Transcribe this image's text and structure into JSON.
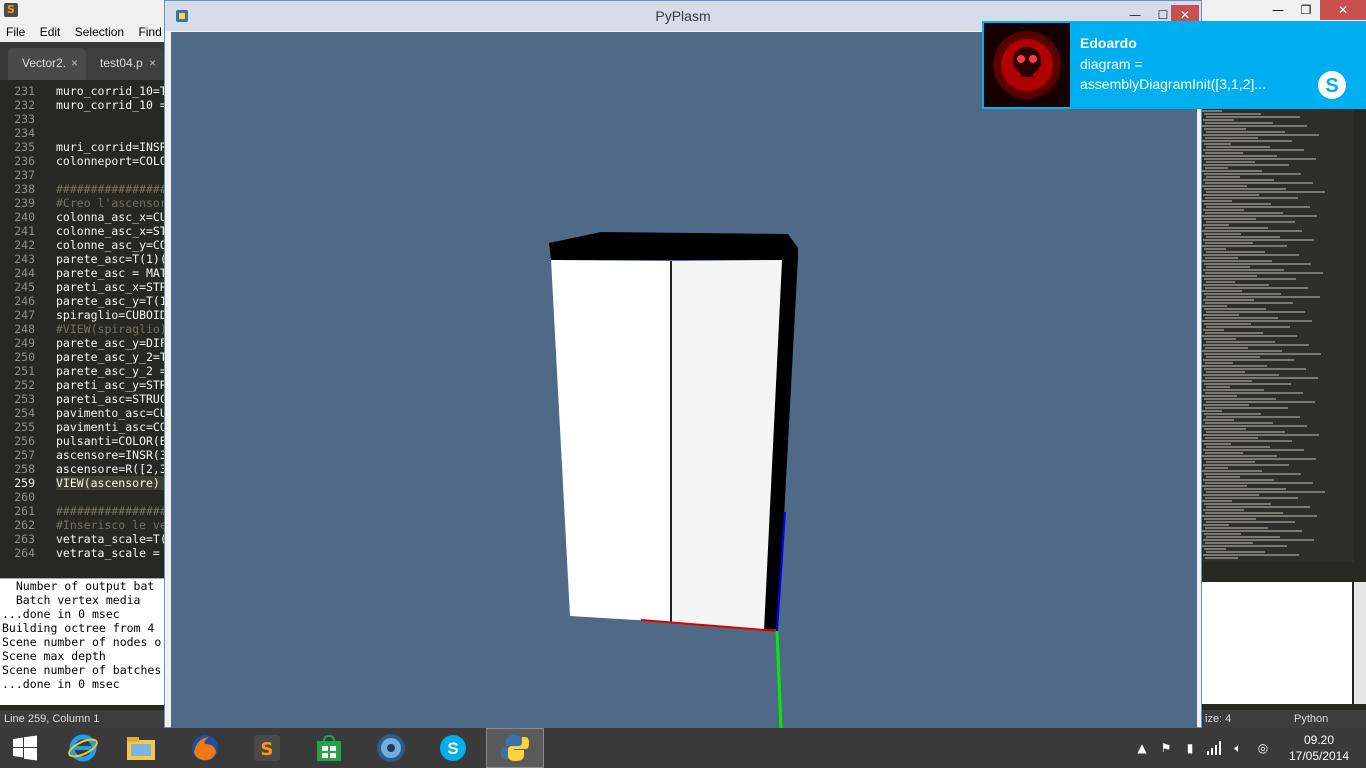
{
  "editor": {
    "menu": [
      "File",
      "Edit",
      "Selection",
      "Find"
    ],
    "tabs": [
      {
        "label": "Vector2.",
        "close": "×"
      },
      {
        "label": "test04.p",
        "close": "×"
      }
    ],
    "lines": [
      {
        "n": "231",
        "code": "muro_corrid_10=T",
        "type": "code"
      },
      {
        "n": "232",
        "code": "muro_corrid_10 =",
        "type": "code"
      },
      {
        "n": "233",
        "code": "",
        "type": "code"
      },
      {
        "n": "234",
        "code": "",
        "type": "code"
      },
      {
        "n": "235",
        "code": "muri_corrid=INSR",
        "type": "code"
      },
      {
        "n": "236",
        "code": "colonneport=COLO",
        "type": "code"
      },
      {
        "n": "237",
        "code": "",
        "type": "code"
      },
      {
        "n": "238",
        "code": "################",
        "type": "com"
      },
      {
        "n": "239",
        "code": "#Creo l'ascensor",
        "type": "com"
      },
      {
        "n": "240",
        "code": "colonna_asc_x=CU",
        "type": "code"
      },
      {
        "n": "241",
        "code": "colonne_asc_x=ST",
        "type": "code"
      },
      {
        "n": "242",
        "code": "colonne_asc_y=CO",
        "type": "code"
      },
      {
        "n": "243",
        "code": "parete_asc=T(1)(",
        "type": "code"
      },
      {
        "n": "244",
        "code": "parete_asc = MAT",
        "type": "code"
      },
      {
        "n": "245",
        "code": "pareti_asc_x=STR",
        "type": "code"
      },
      {
        "n": "246",
        "code": "parete_asc_y=T(1",
        "type": "code"
      },
      {
        "n": "247",
        "code": "spiraglio=CUBOID",
        "type": "code"
      },
      {
        "n": "248",
        "code": "#VIEW(spiraglio)",
        "type": "com"
      },
      {
        "n": "249",
        "code": "parete_asc_y=DIF",
        "type": "code"
      },
      {
        "n": "250",
        "code": "parete_asc_y_2=T",
        "type": "code"
      },
      {
        "n": "251",
        "code": "parete_asc_y_2 =",
        "type": "code"
      },
      {
        "n": "252",
        "code": "pareti_asc_y=STR",
        "type": "code"
      },
      {
        "n": "253",
        "code": "pareti_asc=STRUC",
        "type": "code"
      },
      {
        "n": "254",
        "code": "pavimento_asc=CU",
        "type": "code"
      },
      {
        "n": "255",
        "code": "pavimenti_asc=CO",
        "type": "code"
      },
      {
        "n": "256",
        "code": "pulsanti=COLOR(B",
        "type": "code"
      },
      {
        "n": "257",
        "code": "ascensore=INSR(3",
        "type": "code"
      },
      {
        "n": "258",
        "code": "ascensore=R([2,3",
        "type": "code"
      },
      {
        "n": "259",
        "code": "VIEW(ascensore)",
        "type": "cur"
      },
      {
        "n": "260",
        "code": "",
        "type": "code"
      },
      {
        "n": "261",
        "code": "################",
        "type": "com"
      },
      {
        "n": "262",
        "code": "#Inserisco le ve",
        "type": "com"
      },
      {
        "n": "263",
        "code": "vetrata_scale=T(",
        "type": "code"
      },
      {
        "n": "264",
        "code": "vetrata_scale =",
        "type": "code"
      }
    ],
    "console": [
      "  Number of output bat",
      "  Batch vertex media",
      "...done in 0 msec",
      "Building octree from 4",
      "Scene number of nodes o",
      "Scene max depth",
      "Scene number of batches",
      "...done in 0 msec"
    ],
    "status_left": "Line 259, Column 1",
    "status_mid": "ize: 4",
    "status_right": "Python",
    "close_glyph": "✕",
    "min_glyph": "—",
    "max_glyph": "❐"
  },
  "pyplasm": {
    "title": "PyPlasm",
    "min_glyph": "—",
    "max_glyph": "☐",
    "close_glyph": "✕",
    "viewport_bg": "#4e6a86",
    "axis_colors": {
      "x": "#e00000",
      "y": "#00ee00",
      "z": "#0000ff"
    }
  },
  "notification": {
    "sender": "Edoardo",
    "line1": "diagram =",
    "line2": "assemblyDiagramInit([3,1,2]...",
    "accent": "#00aff0",
    "icon": "skype-icon"
  },
  "taskbar": {
    "apps": [
      {
        "name": "file-explorer-icon",
        "active": false
      },
      {
        "name": "firefox-icon",
        "active": false
      },
      {
        "name": "sublime-text-icon",
        "active": false
      },
      {
        "name": "windows-store-icon",
        "active": false
      },
      {
        "name": "media-player-icon",
        "active": false
      },
      {
        "name": "skype-icon",
        "active": false
      },
      {
        "name": "python-icon",
        "active": true
      }
    ],
    "time": "09.20",
    "date": "17/05/2014"
  }
}
